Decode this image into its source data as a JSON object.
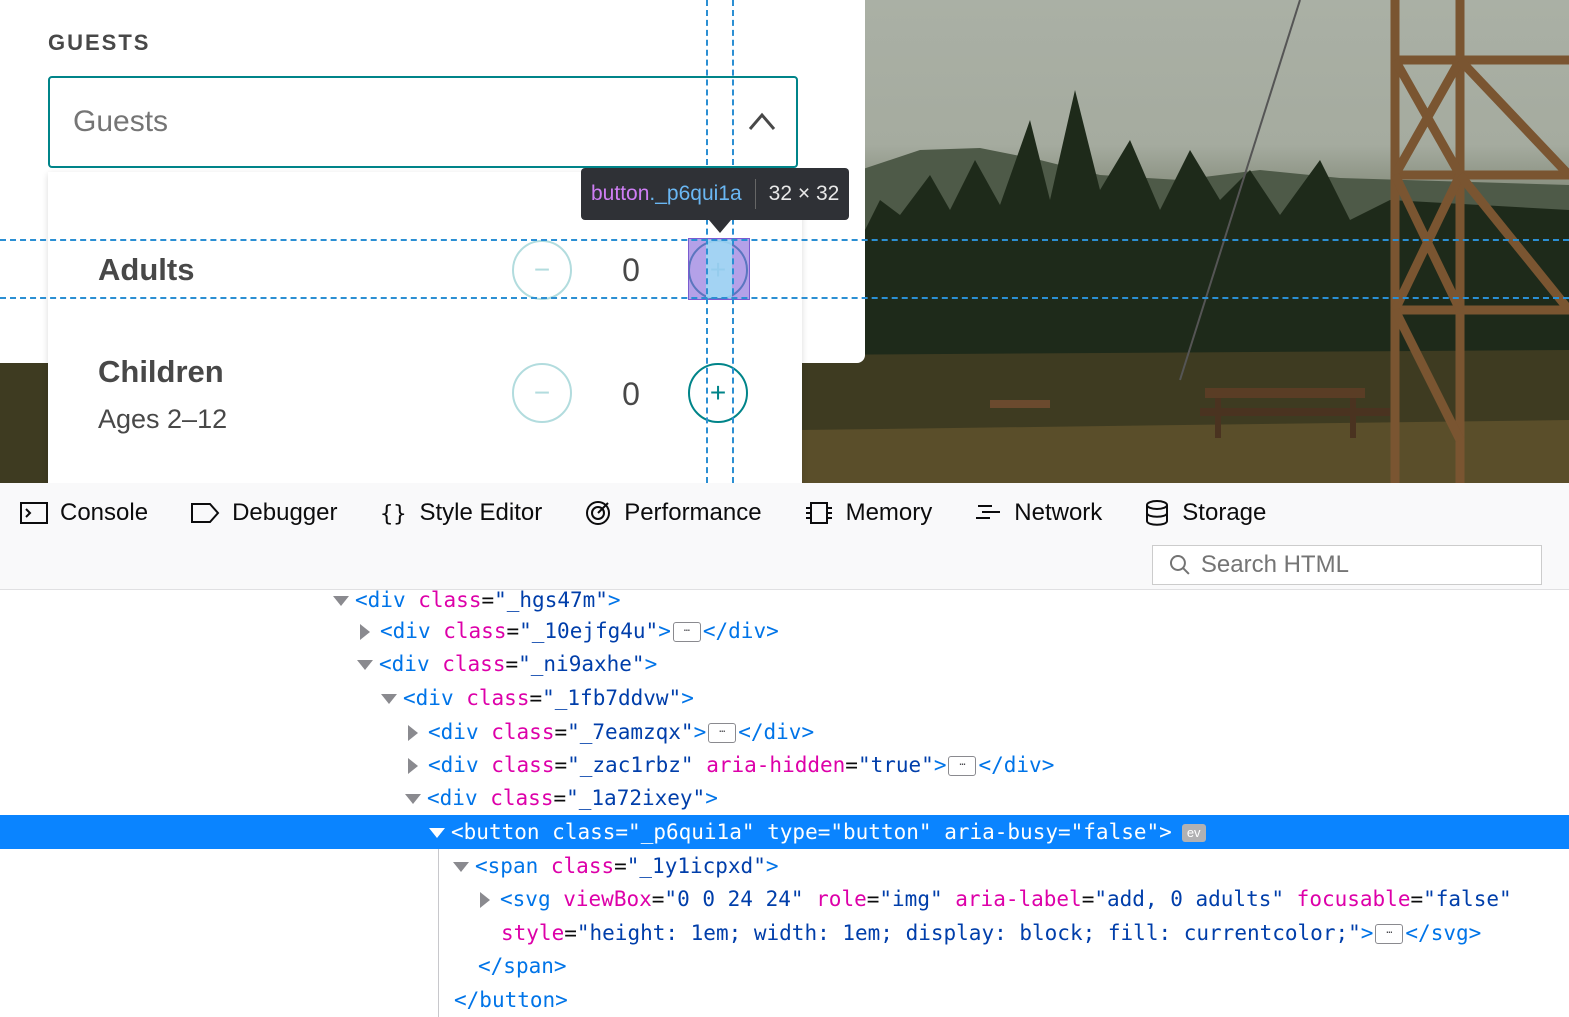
{
  "page": {
    "guests_heading": "GUESTS",
    "guests_select_placeholder": "Guests",
    "rows": [
      {
        "label": "Adults",
        "sublabel": "",
        "count": "0",
        "minus": "−",
        "plus": "+"
      },
      {
        "label": "Children",
        "sublabel": "Ages 2–12",
        "count": "0",
        "minus": "−",
        "plus": "+"
      }
    ],
    "colors": {
      "accent": "#008489",
      "accent_dim": "#b2dcde",
      "text": "#484848"
    }
  },
  "inspector_tooltip": {
    "tag": "button",
    "class": "._p6qui1a",
    "dimensions": "32 × 32"
  },
  "devtools": {
    "tabs": [
      {
        "label": "Console",
        "icon": "console-icon"
      },
      {
        "label": "Debugger",
        "icon": "debugger-icon"
      },
      {
        "label": "Style Editor",
        "icon": "style-editor-icon"
      },
      {
        "label": "Performance",
        "icon": "performance-icon"
      },
      {
        "label": "Memory",
        "icon": "memory-icon"
      },
      {
        "label": "Network",
        "icon": "network-icon"
      },
      {
        "label": "Storage",
        "icon": "storage-icon"
      }
    ],
    "search_placeholder": "Search HTML",
    "markup": {
      "l0": {
        "tag": "div",
        "attr": "class",
        "val": "\"_hgs47m\""
      },
      "l1": {
        "tag": "div",
        "attr": "class",
        "val": "\"_10ejfg4u\""
      },
      "l2": {
        "tag": "div",
        "attr": "class",
        "val": "\"_ni9axhe\""
      },
      "l3": {
        "tag": "div",
        "attr": "class",
        "val": "\"_1fb7ddvw\""
      },
      "l4": {
        "tag": "div",
        "attr": "class",
        "val": "\"_7eamzqx\""
      },
      "l5": {
        "tag": "div",
        "attr": "class",
        "val": "\"_zac1rbz\"",
        "attr2": "aria-hidden",
        "val2": "\"true\""
      },
      "l6": {
        "tag": "div",
        "attr": "class",
        "val": "\"_1a72ixey\""
      },
      "l7": {
        "tag": "button",
        "attr": "class",
        "val": "\"_p6qui1a\"",
        "attr2": "type",
        "val2": "\"button\"",
        "attr3": "aria-busy",
        "val3": "\"false\"",
        "badge": "ev"
      },
      "l8": {
        "tag": "span",
        "attr": "class",
        "val": "\"_1y1icpxd\""
      },
      "l9": {
        "tag": "svg",
        "attr": "viewBox",
        "val": "\"0 0 24 24\"",
        "attr2": "role",
        "val2": "\"img\"",
        "attr3": "aria-label",
        "val3": "\"add, 0 adults\"",
        "attr4": "focusable",
        "val4": "\"false\""
      },
      "l10": {
        "attr": "style",
        "val": "\"height: 1em; width: 1em; display: block; fill: currentcolor;\"",
        "close": "svg"
      },
      "l11": {
        "close": "span"
      },
      "l12": {
        "close": "button"
      },
      "ellipsis": "…"
    }
  }
}
